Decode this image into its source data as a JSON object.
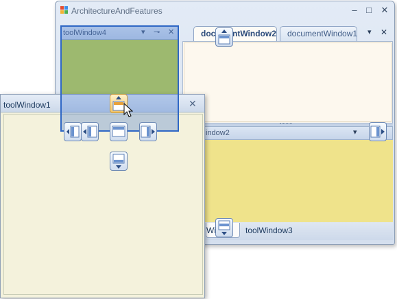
{
  "window": {
    "title": "ArchitectureAndFeatures",
    "minimize_glyph": "–",
    "maximize_glyph": "□",
    "close_glyph": "✕"
  },
  "tool_window_4": {
    "title": "toolWindow4",
    "menu_glyph": "▾",
    "pin_glyph": "⊸",
    "close_glyph": "✕",
    "body_color": "#c7d73b"
  },
  "documents": {
    "tabs": [
      {
        "label": "documentWindow2",
        "visible_label": "doc tWindow2",
        "active": true
      },
      {
        "label": "documentWindow1",
        "active": false
      }
    ],
    "menu_glyph": "▾",
    "close_glyph": "✕"
  },
  "tool_window_2": {
    "title": "indow2",
    "menu_glyph": "▾",
    "close_glyph": "✕",
    "body_color": "#efe38b"
  },
  "bottom_tabs": [
    {
      "label": "Wi  2",
      "active": true
    },
    {
      "label": "toolWindow3",
      "active": false
    }
  ],
  "tool_window_1": {
    "title": "toolWindow1",
    "close_glyph": "✕",
    "body_color": "#f4f2dc"
  },
  "colors": {
    "dock_preview": "#2f67c5",
    "guide_active": "#f2c46a"
  }
}
